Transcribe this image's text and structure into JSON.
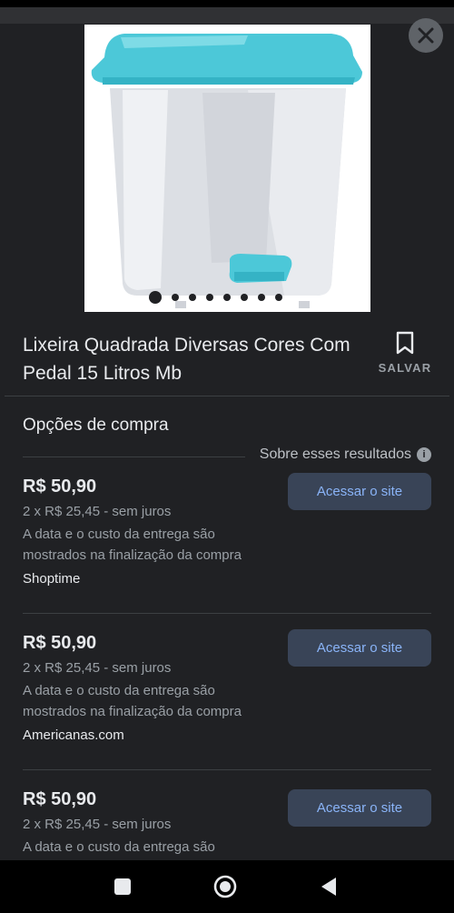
{
  "product": {
    "title": "Lixeira Quadrada Diversas Cores Com Pedal 15 Litros Mb",
    "save_label": "SALVAR",
    "image_count": 8,
    "active_image": 0
  },
  "shopping": {
    "section_title": "Opções de compra",
    "about_label": "Sobre esses resultados",
    "offers": [
      {
        "price": "R$ 50,90",
        "installments": "2 x R$ 25,45 - sem juros",
        "shipping_note": "A data e o custo da entrega são mostrados na finalização da compra",
        "seller": "Shoptime",
        "button_label": "Acessar o site"
      },
      {
        "price": "R$ 50,90",
        "installments": "2 x R$ 25,45 - sem juros",
        "shipping_note": "A data e o custo da entrega são mostrados na finalização da compra",
        "seller": "Americanas.com",
        "button_label": "Acessar o site"
      },
      {
        "price": "R$ 50,90",
        "installments": "2 x R$ 25,45 - sem juros",
        "shipping_note": "A data e o custo da entrega são",
        "seller": "",
        "button_label": "Acessar o site"
      }
    ]
  },
  "icons": {
    "close": "close-icon",
    "bookmark": "bookmark-icon",
    "info": "info-icon",
    "nav_recents": "square-icon",
    "nav_home": "circle-icon",
    "nav_back": "back-triangle-icon"
  },
  "colors": {
    "background": "#202124",
    "link_blue": "#8ab4f8",
    "button_bg": "#394457",
    "product_lid": "#4cc8d8"
  }
}
